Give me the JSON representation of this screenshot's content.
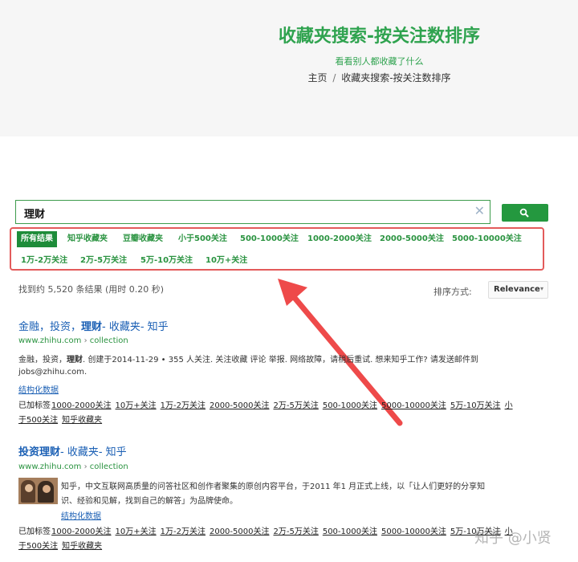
{
  "header": {
    "title": "收藏夹搜索-按关注数排序",
    "subtitle": "看看别人都收藏了什么",
    "breadcrumb": [
      "主页",
      "收藏夹搜索-按关注数排序"
    ],
    "breadcrumb_sep": "/"
  },
  "search": {
    "query": "理财",
    "clear_icon": "close-icon",
    "button_icon": "search-icon"
  },
  "filters": {
    "row1": [
      "所有结果",
      "知乎收藏夹",
      "豆瓣收藏夹",
      "小于500关注",
      "500-1000关注",
      "1000-2000关注",
      "2000-5000关注",
      "5000-10000关注"
    ],
    "row2": [
      "1万-2万关注",
      "2万-5万关注",
      "5万-10万关注",
      "10万+关注"
    ]
  },
  "results_info": "找到约 5,520 条结果 (用时 0.20 秒)",
  "sort": {
    "label": "排序方式:",
    "value": "Relevance"
  },
  "results": [
    {
      "title_prefix": "金融，投资，",
      "title_bold": "理财",
      "title_suffix": "- 收藏夹- 知乎",
      "url": "www.zhihu.com",
      "url_sep": "›",
      "url_path": "collection",
      "snippet_line1_a": "金融，投资，",
      "snippet_bold": "理财",
      "snippet_line1_b": ". 创建于2014-11-29 • 355 人关注. 关注收藏  评论  举报. 网络故障，请稍后重试. 想来知乎工作? 请发送邮件到",
      "snippet_line2": "jobs@zhihu.com.",
      "structured_link": "结构化数据",
      "tags_label": "已加标签",
      "tags_line1": [
        "1000-2000关注",
        "10万+关注",
        "1万-2万关注",
        "2000-5000关注",
        "2万-5万关注",
        "500-1000关注",
        "5000-10000关注",
        "5万-10万关注",
        "小"
      ],
      "tags_line2": [
        "于500关注",
        "知乎收藏夹"
      ]
    },
    {
      "title_bold": "投资理财",
      "title_suffix": "- 收藏夹- 知乎",
      "url": "www.zhihu.com",
      "url_sep": "›",
      "url_path": "collection",
      "snippet_line1": "知乎，中文互联网高质量的问答社区和创作者聚集的原创内容平台，于2011 年1 月正式上线，以「让人们更好的分享知",
      "snippet_line2": "识、经验和见解，找到自己的解答」为品牌使命。",
      "structured_link": "结构化数据",
      "tags_label": "已加标签",
      "tags_line1": [
        "1000-2000关注",
        "10万+关注",
        "1万-2万关注",
        "2000-5000关注",
        "2万-5万关注",
        "500-1000关注",
        "5000-10000关注",
        "5万-10万关注",
        "小"
      ],
      "tags_line2": [
        "于500关注",
        "知乎收藏夹"
      ]
    }
  ],
  "watermark": "知乎 @小贤",
  "colors": {
    "accent": "#24983f",
    "link": "#1a5fb4",
    "annotation": "#e35b5b"
  }
}
